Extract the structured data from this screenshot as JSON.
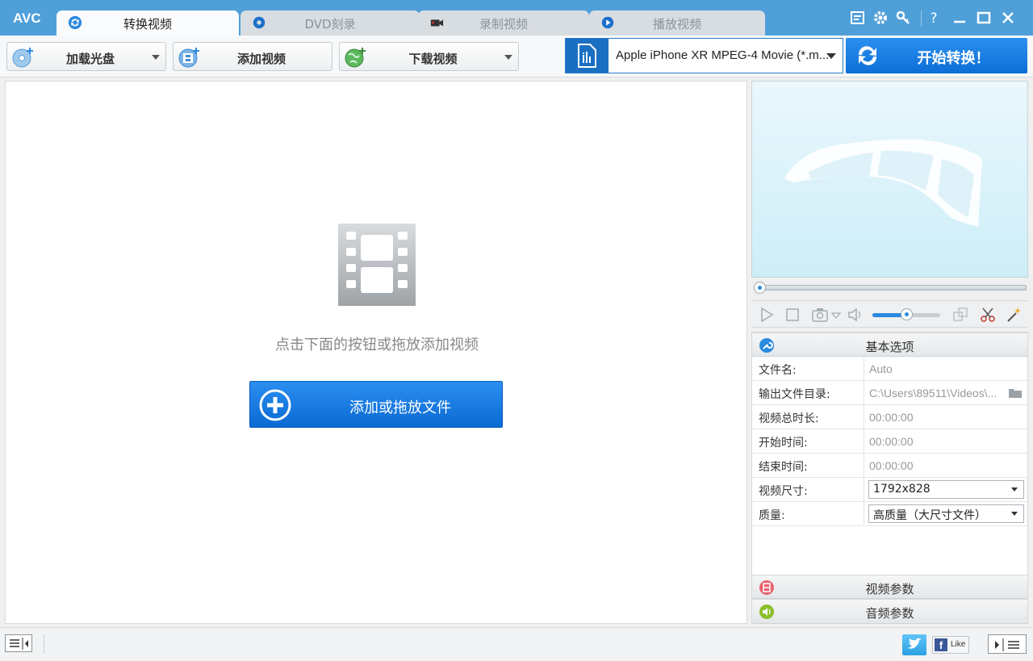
{
  "app": {
    "logo": "AVC"
  },
  "tabs": [
    {
      "label": "转换视频",
      "icon": "convert-refresh-icon",
      "active": true
    },
    {
      "label": "DVD刻录",
      "icon": "disc-icon",
      "active": false
    },
    {
      "label": "录制视频",
      "icon": "camera-icon",
      "active": false
    },
    {
      "label": "播放视频",
      "icon": "play-circle-icon",
      "active": false
    }
  ],
  "window_controls": [
    "skin-icon",
    "settings-icon",
    "key-icon",
    "help-icon",
    "minimize-icon",
    "maximize-icon",
    "close-icon"
  ],
  "help_glyph": "?",
  "toolbar": {
    "load_disc_label": "加载光盘",
    "add_video_label": "添加视频",
    "download_video_label": "下载视频",
    "profile_label": "Apple iPhone XR MPEG-4 Movie (*.m...",
    "convert_label": "开始转换！"
  },
  "drop_area": {
    "hint": "点击下面的按钮或拖放添加视频",
    "add_button_label": "添加或拖放文件"
  },
  "player": {
    "seek_fraction": 0.0,
    "volume_fraction": 0.5
  },
  "basic_options": {
    "title": "基本选项",
    "rows": [
      {
        "label": "文件名:",
        "value": "Auto"
      },
      {
        "label": "输出文件目录:",
        "value": "C:\\Users\\89511\\Videos\\..."
      },
      {
        "label": "视频总时长:",
        "value": "00:00:00"
      },
      {
        "label": "开始时间:",
        "value": "00:00:00"
      },
      {
        "label": "结束时间:",
        "value": "00:00:00"
      },
      {
        "label": "视频尺寸:",
        "value": "1792x828"
      },
      {
        "label": "质量:",
        "value": "高质量（大尺寸文件）"
      }
    ]
  },
  "video_params_title": "视频参数",
  "audio_params_title": "音频参数",
  "social": {
    "like_label": "Like",
    "facebook_glyph": "f"
  },
  "colors": {
    "accent": "#4f9fd9",
    "primary_button": "#1a7be0",
    "video_params_icon": "#e8636b",
    "audio_params_icon": "#8bbf2c"
  }
}
